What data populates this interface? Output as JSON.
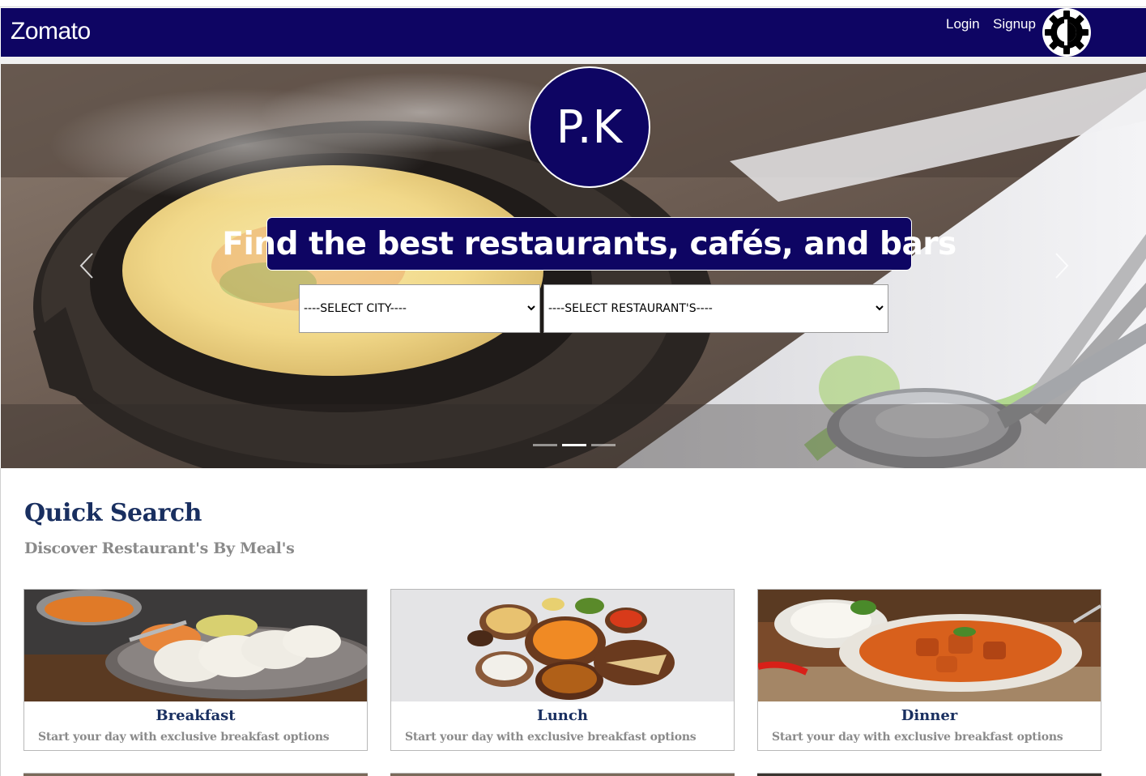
{
  "navbar": {
    "brand": "Zomato",
    "login_label": "Login",
    "signup_label": "Signup",
    "bg_color": "#0e0563"
  },
  "hero": {
    "logo_text": "P.K",
    "headline": "Find the best restaurants, cafés, and bars",
    "city_select": {
      "selected": "----SELECT CITY----"
    },
    "restaurant_select": {
      "selected": "----SELECT RESTAURANT'S----"
    },
    "carousel": {
      "slide_count": 3,
      "active_index": 1
    }
  },
  "quick_search": {
    "title": "Quick Search",
    "subtitle": "Discover Restaurant's By Meal's",
    "meals": [
      {
        "title": "Breakfast",
        "description": "Start your day with exclusive breakfast options"
      },
      {
        "title": "Lunch",
        "description": "Start your day with exclusive breakfast options"
      },
      {
        "title": "Dinner",
        "description": "Start your day with exclusive breakfast options"
      }
    ]
  },
  "colors": {
    "primary": "#0e0563",
    "heading": "#192f60",
    "muted": "#8a8a8a"
  }
}
